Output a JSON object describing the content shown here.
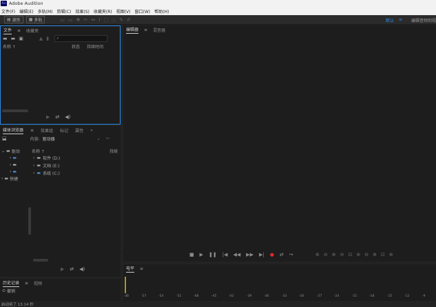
{
  "app": {
    "logo": "Au",
    "title": "Adobe Audition"
  },
  "menu": [
    "文件(F)",
    "编辑(E)",
    "多轨(M)",
    "剪辑(C)",
    "效果(S)",
    "收藏夹(R)",
    "视图(V)",
    "窗口(W)",
    "帮助(H)"
  ],
  "toolbar": {
    "waveform_label": "波形",
    "multitrack_label": "多轨",
    "workspace_default": "默认",
    "workspace_menu_icon": "≡",
    "workspace_edit": "编辑音频到视"
  },
  "files_panel": {
    "tabs": [
      "文件",
      "收藏夹"
    ],
    "search_placeholder": "",
    "columns": {
      "name": "名称 ↑",
      "status": "状态",
      "duration": "持续时间"
    }
  },
  "media_panel": {
    "tabs": [
      "媒体浏览器",
      "效果组",
      "标记",
      "属性"
    ],
    "content_label": "内容:",
    "content_value": "驱动器",
    "col_name": "名称 ↑",
    "col_duration": "持续",
    "tree_left": [
      "驱动",
      "快捷"
    ],
    "drives": [
      "软件 (D:)",
      "文档 (E:)",
      "系统 (C:)"
    ]
  },
  "history_panel": {
    "tabs": [
      "历史记录",
      "视频"
    ],
    "item": "撤销"
  },
  "editor_panel": {
    "tabs": [
      "编辑器",
      "混音器"
    ]
  },
  "level_panel": {
    "title": "电平",
    "ticks": [
      "dB",
      "-57",
      "-54",
      "-51",
      "-48",
      "-45",
      "-42",
      "-39",
      "-36",
      "-33",
      "-30",
      "-27",
      "-24",
      "-21",
      "-18",
      "-15",
      "-12",
      "-9"
    ]
  },
  "status_bar": {
    "text": "启动用了 13.14 秒"
  },
  "colors": {
    "accent": "#2d8ceb",
    "record": "#e02a2a",
    "panel_focus_border": "#2d8ceb"
  }
}
